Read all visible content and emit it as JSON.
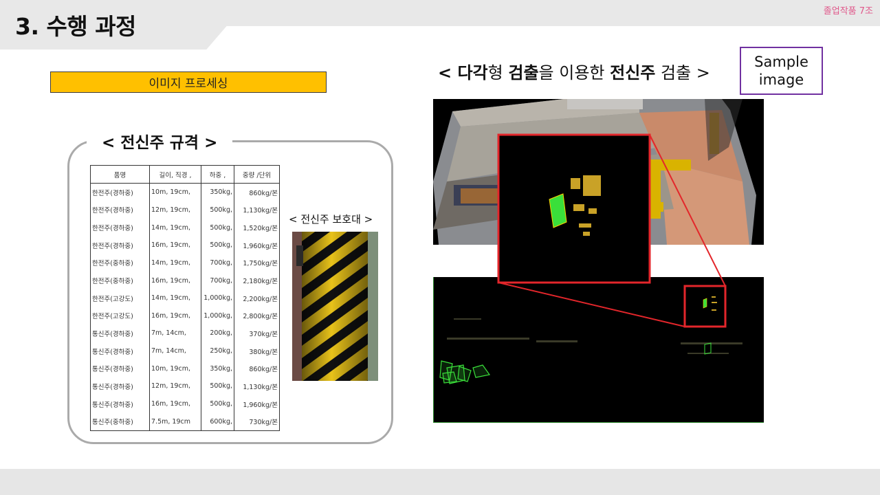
{
  "header": {
    "title": "3. 수행 과정",
    "corner_tag": "졸업작품 7조"
  },
  "section_label": "이미지 프로세싱",
  "spec": {
    "heading": "< 전신주 규격 >",
    "columns": [
      "품명",
      "길이, 직경 ,",
      "하중 ,",
      "중량 /단위"
    ],
    "rows": [
      [
        "한전주(경하중)",
        "10m, 19cm,",
        "350kg,",
        "860kg/본"
      ],
      [
        "한전주(경하중)",
        "12m, 19cm,",
        "500kg,",
        "1,130kg/본"
      ],
      [
        "한전주(경하중)",
        "14m, 19cm,",
        "500kg,",
        "1,520kg/본"
      ],
      [
        "한전주(경하중)",
        "16m, 19cm,",
        "500kg,",
        "1,960kg/본"
      ],
      [
        "한전주(중하중)",
        "14m, 19cm,",
        "700kg,",
        "1,750kg/본"
      ],
      [
        "한전주(중하중)",
        "16m, 19cm,",
        "700kg,",
        "2,180kg/본"
      ],
      [
        "한전주(고강도)",
        "14m, 19cm,",
        "1,000kg,",
        "2,200kg/본"
      ],
      [
        "한전주(고강도)",
        "16m, 19cm,",
        "1,000kg,",
        "2,800kg/본"
      ],
      [
        "통신주(경하중)",
        "7m, 14cm,",
        "200kg,",
        "370kg/본"
      ],
      [
        "통신주(경하중)",
        "7m, 14cm,",
        "250kg,",
        "380kg/본"
      ],
      [
        "통신주(경하중)",
        "10m, 19cm,",
        "350kg,",
        "860kg/본"
      ],
      [
        "통신주(경하중)",
        "12m, 19cm,",
        "500kg,",
        "1,130kg/본"
      ],
      [
        "통신주(경하중)",
        "16m, 19cm,",
        "500kg,",
        "1,960kg/본"
      ],
      [
        "통신주(중하중)",
        "7.5m, 19cm",
        "600kg,",
        "730kg/본"
      ]
    ]
  },
  "pole_guard": {
    "label": "< 전신주 보호대 >",
    "stripe_color": "#e8c21a"
  },
  "detection": {
    "title_parts": [
      {
        "text": "< ",
        "bold": true
      },
      {
        "text": "다각",
        "bold": true
      },
      {
        "text": "형 ",
        "bold": false
      },
      {
        "text": "검출",
        "bold": true
      },
      {
        "text": "을 이용한 ",
        "bold": false
      },
      {
        "text": "전신주",
        "bold": true
      },
      {
        "text": " 검출 >",
        "bold": false
      }
    ],
    "sample_label_line1": "Sample",
    "sample_label_line2": "image",
    "highlight_color": "#e3262b",
    "detection_color": "#3adf3a"
  }
}
